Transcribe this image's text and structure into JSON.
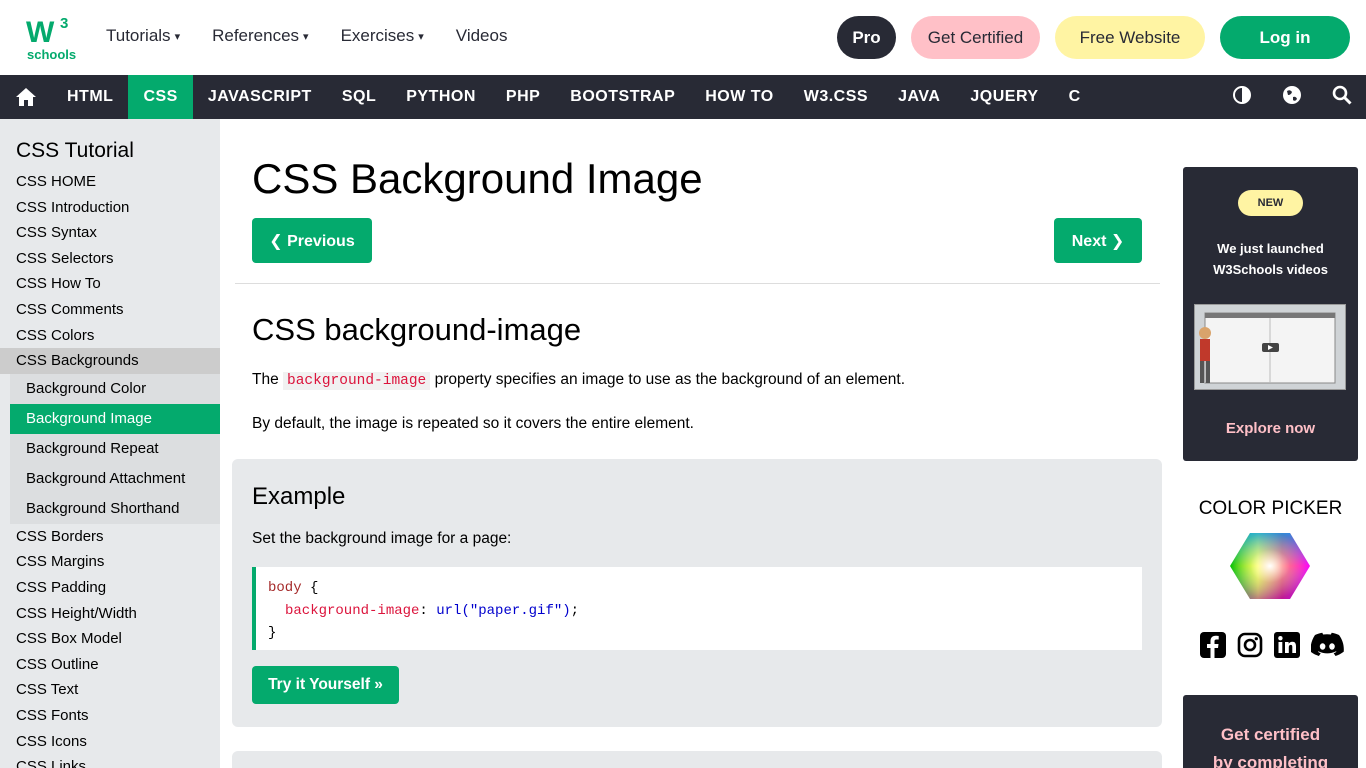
{
  "topbar": {
    "logo_text": "schools",
    "logo_superscript": "3",
    "nav": [
      {
        "label": "Tutorials",
        "caret": "▾"
      },
      {
        "label": "References",
        "caret": "▾"
      },
      {
        "label": "Exercises",
        "caret": "▾"
      },
      {
        "label": "Videos",
        "caret": ""
      }
    ],
    "pro": "Pro",
    "get_certified": "Get Certified",
    "free_website": "Free Website",
    "login": "Log in"
  },
  "darknav": {
    "items": [
      "HTML",
      "CSS",
      "JAVASCRIPT",
      "SQL",
      "PYTHON",
      "PHP",
      "BOOTSTRAP",
      "HOW TO",
      "W3.CSS",
      "JAVA",
      "JQUERY",
      "C"
    ],
    "active": "CSS",
    "icons": [
      "home-icon",
      "contrast-icon",
      "globe-icon",
      "search-icon"
    ]
  },
  "sidebar": {
    "title": "CSS Tutorial",
    "items_before": [
      "CSS HOME",
      "CSS Introduction",
      "CSS Syntax",
      "CSS Selectors",
      "CSS How To",
      "CSS Comments",
      "CSS Colors"
    ],
    "group": "CSS Backgrounds",
    "sub_items": [
      "Background Color",
      "Background Image",
      "Background Repeat",
      "Background Attachment",
      "Background Shorthand"
    ],
    "active_sub": "Background Image",
    "items_after": [
      "CSS Borders",
      "CSS Margins",
      "CSS Padding",
      "CSS Height/Width",
      "CSS Box Model",
      "CSS Outline",
      "CSS Text",
      "CSS Fonts",
      "CSS Icons",
      "CSS Links"
    ]
  },
  "main": {
    "title": "CSS Background Image",
    "prev": "❮ Previous",
    "next": "Next ❯",
    "section_title": "CSS background-image",
    "para1_before": "The",
    "para1_code": "background-image",
    "para1_after": "property specifies an image to use as the background of an element.",
    "para2": "By default, the image is repeated so it covers the entire element.",
    "example": {
      "heading": "Example",
      "desc": "Set the background image for a page:",
      "code_selector": "body",
      "code_open": " {",
      "code_prop": "background-image",
      "code_colon": ": ",
      "code_value": "url(\"paper.gif\")",
      "code_semicolon": ";",
      "code_close": "}",
      "try_button": "Try it Yourself »"
    }
  },
  "rightcol": {
    "badge": "NEW",
    "promo_line1": "We just launched",
    "promo_line2": "W3Schools videos",
    "explore": "Explore now",
    "color_picker": "COLOR PICKER",
    "socials": [
      "facebook-icon",
      "instagram-icon",
      "linkedin-icon",
      "discord-icon"
    ],
    "cert_line1": "Get certified",
    "cert_line2": "by completing"
  },
  "colors": {
    "brand_green": "#04aa6d",
    "dark": "#282a35",
    "pink": "#ffc0c7",
    "yellow": "#fff4a3"
  }
}
